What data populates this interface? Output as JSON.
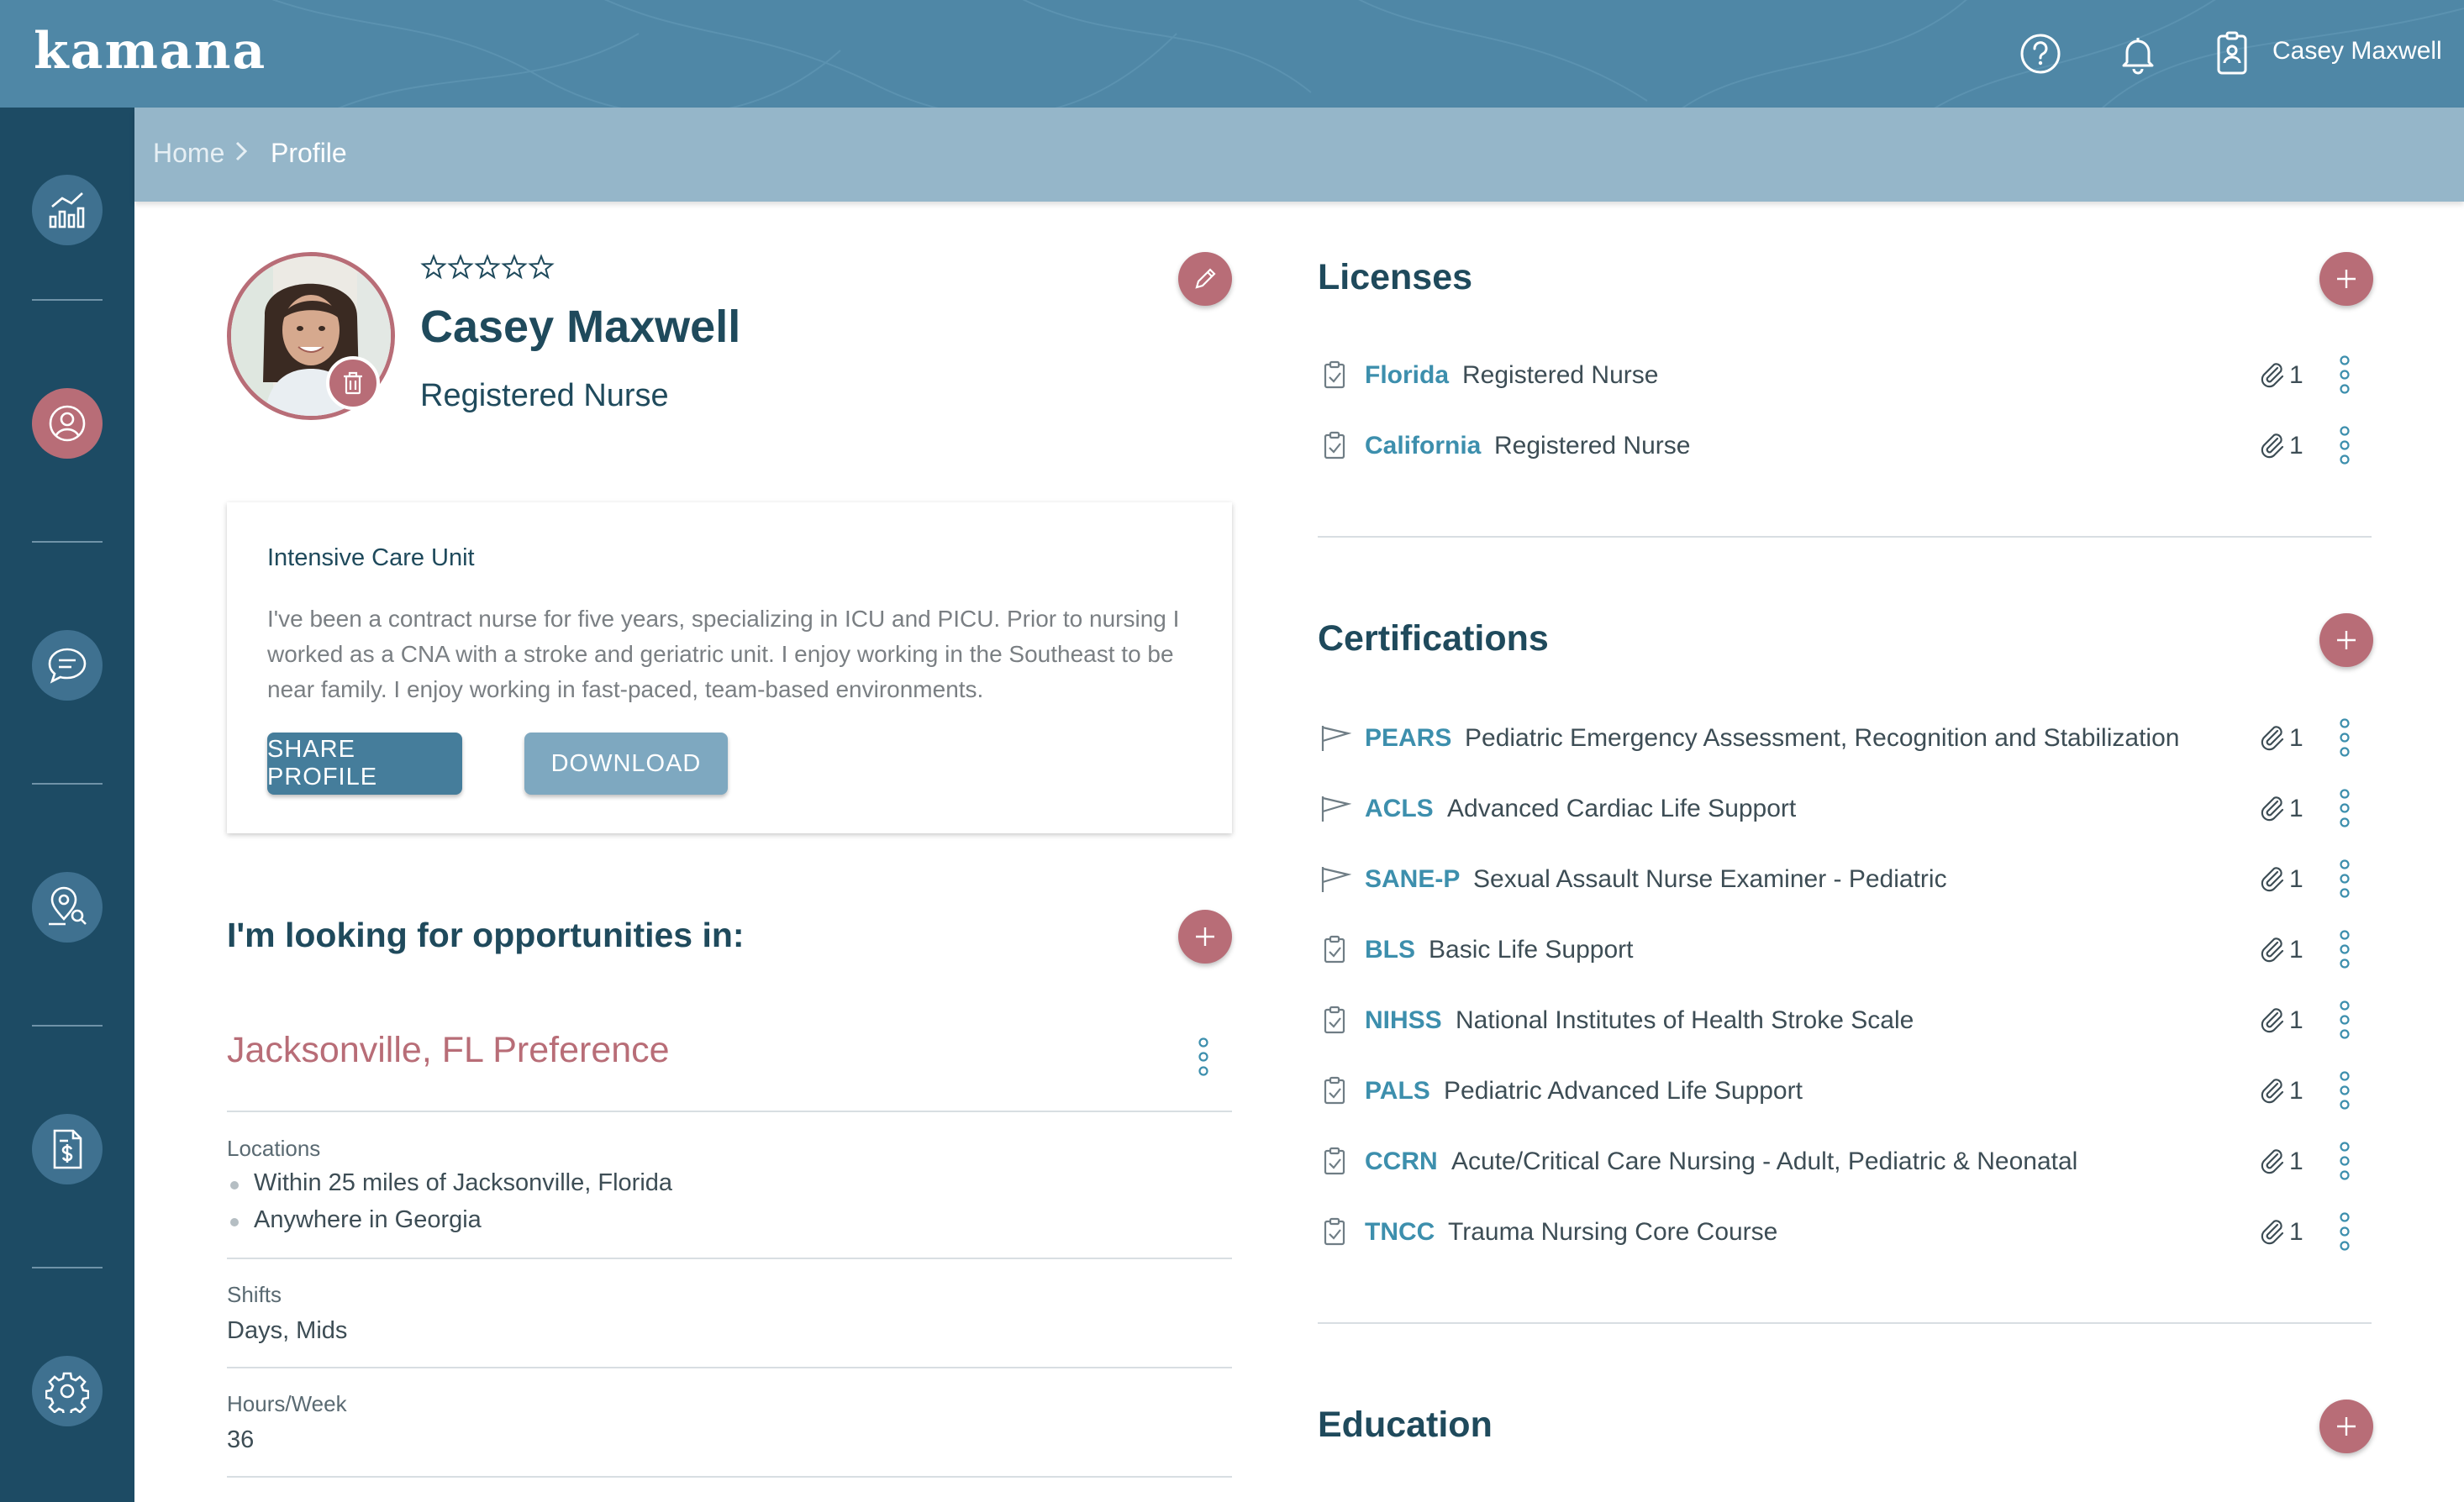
{
  "app": {
    "logo": "kamana",
    "user_name": "Casey Maxwell"
  },
  "header": {
    "help_icon": "help-circle-icon",
    "bell_icon": "bell-icon",
    "badge_icon": "id-badge-icon"
  },
  "sidebar": {
    "items": [
      {
        "name": "dashboard",
        "icon": "chart-icon"
      },
      {
        "name": "profile",
        "icon": "user-circle-icon",
        "active": true
      },
      {
        "name": "messages",
        "icon": "chat-icon"
      },
      {
        "name": "search-jobs",
        "icon": "location-search-icon"
      },
      {
        "name": "payments",
        "icon": "invoice-dollar-icon"
      },
      {
        "name": "settings",
        "icon": "gear-icon"
      }
    ]
  },
  "breadcrumb": {
    "home": "Home",
    "current": "Profile"
  },
  "profile": {
    "name": "Casey Maxwell",
    "title": "Registered Nurse",
    "rating": 0,
    "rating_max": 5,
    "unit": "Intensive Care Unit",
    "bio": "I've been a contract nurse for five years, specializing in ICU and PICU. Prior to nursing I worked as a CNA with a stroke and geriatric unit. I enjoy working in the Southeast to be near family. I enjoy working in fast-paced, team-based environments.",
    "share_label": "SHARE PROFILE",
    "download_label": "DOWNLOAD"
  },
  "opportunities": {
    "heading": "I'm looking for opportunities in:",
    "preference_title": "Jacksonville, FL Preference",
    "locations_label": "Locations",
    "locations": [
      "Within 25 miles of Jacksonville, Florida",
      "Anywhere in Georgia"
    ],
    "shifts_label": "Shifts",
    "shifts": "Days, Mids",
    "hours_label": "Hours/Week",
    "hours": "36"
  },
  "licenses": {
    "heading": "Licenses",
    "items": [
      {
        "code": "Florida",
        "desc": "Registered Nurse",
        "attachments": "1",
        "icon": "clipboard-check-icon"
      },
      {
        "code": "California",
        "desc": "Registered Nurse",
        "attachments": "1",
        "icon": "clipboard-check-icon"
      }
    ]
  },
  "certifications": {
    "heading": "Certifications",
    "items": [
      {
        "code": "PEARS",
        "desc": "Pediatric Emergency Assessment, Recognition and Stabilization",
        "attachments": "1",
        "icon": "flag-icon"
      },
      {
        "code": "ACLS",
        "desc": "Advanced Cardiac Life Support",
        "attachments": "1",
        "icon": "flag-icon"
      },
      {
        "code": "SANE-P",
        "desc": "Sexual Assault Nurse Examiner - Pediatric",
        "attachments": "1",
        "icon": "flag-icon"
      },
      {
        "code": "BLS",
        "desc": "Basic Life Support",
        "attachments": "1",
        "icon": "clipboard-check-icon"
      },
      {
        "code": "NIHSS",
        "desc": "National Institutes of Health Stroke Scale",
        "attachments": "1",
        "icon": "clipboard-check-icon"
      },
      {
        "code": "PALS",
        "desc": "Pediatric Advanced Life Support",
        "attachments": "1",
        "icon": "clipboard-check-icon"
      },
      {
        "code": "CCRN",
        "desc": "Acute/Critical Care Nursing - Adult, Pediatric & Neonatal",
        "attachments": "1",
        "icon": "clipboard-check-icon"
      },
      {
        "code": "TNCC",
        "desc": "Trauma Nursing Core Course",
        "attachments": "1",
        "icon": "clipboard-check-icon"
      }
    ]
  },
  "education": {
    "heading": "Education"
  },
  "colors": {
    "header": "#4f87a6",
    "sidebar": "#1d4b64",
    "accent": "#b86d77",
    "link": "#3d8fad",
    "breadcrumb_bar": "#95b6c9"
  }
}
